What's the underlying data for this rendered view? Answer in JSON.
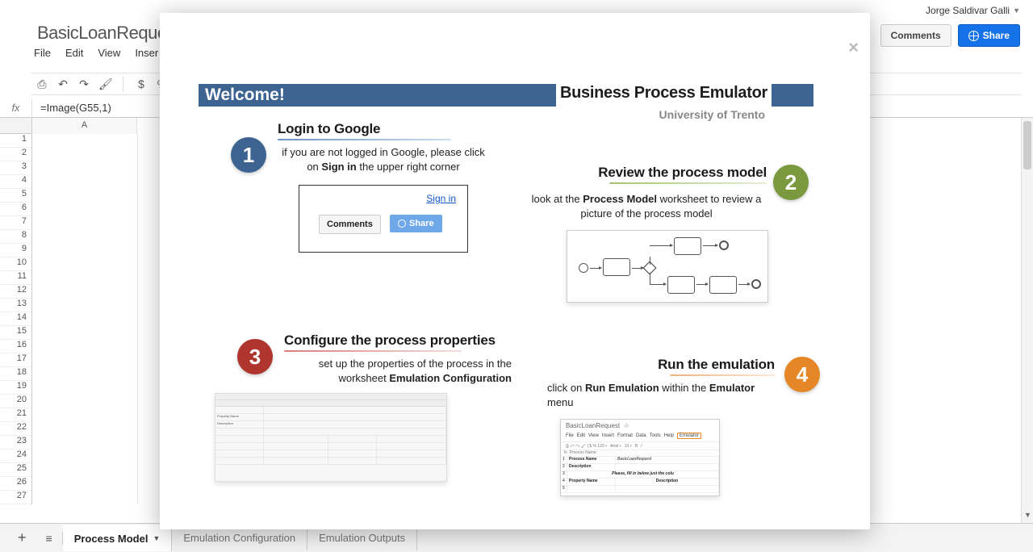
{
  "user": {
    "name": "Jorge Saldivar Galli"
  },
  "doc_title": "BasicLoanReques",
  "buttons": {
    "comments": "Comments",
    "share": "Share"
  },
  "menus": [
    "File",
    "Edit",
    "View",
    "Inser"
  ],
  "toolbar": {
    "dollar": "$",
    "percent": "%"
  },
  "formula": {
    "label": "fx",
    "value": "=Image(G55,1)"
  },
  "columns": [
    "A"
  ],
  "rows": [
    "1",
    "2",
    "3",
    "4",
    "5",
    "6",
    "7",
    "8",
    "9",
    "10",
    "11",
    "12",
    "13",
    "14",
    "15",
    "16",
    "17",
    "18",
    "19",
    "20",
    "21",
    "22",
    "23",
    "24",
    "25",
    "26",
    "27"
  ],
  "sheet_tabs": {
    "add": "+",
    "menu": "≡",
    "active": "Process Model",
    "t2": "Emulation Configuration",
    "t3": "Emulation Outputs"
  },
  "modal": {
    "close": "×",
    "welcome": "Welcome!",
    "app_title": "Business Process Emulator",
    "app_subtitle": "University of Trento",
    "step1": {
      "num": "1",
      "title": "Login to Google",
      "desc_a": "if you are not logged in Google, please click on ",
      "desc_b": "Sign in",
      "desc_c": " the upper right corner",
      "signin": "Sign in",
      "comments": "Comments",
      "share": "Share"
    },
    "step2": {
      "num": "2",
      "title": "Review the process model",
      "desc_a": "look at the ",
      "desc_b": "Process Model",
      "desc_c": " worksheet to review a picture of the process model"
    },
    "step3": {
      "num": "3",
      "title": "Configure the process properties",
      "desc_a": "set up the properties of the process in the worksheet ",
      "desc_b": "Emulation Configuration"
    },
    "step4": {
      "num": "4",
      "title": "Run the emulation",
      "desc_a": "click on ",
      "desc_b": "Run Emulation",
      "desc_c": " within the ",
      "desc_d": "Emulator",
      "desc_e": " menu",
      "thumb_title": "BasicLoanRequest",
      "thumb_menus": [
        "File",
        "Edit",
        "View",
        "Insert",
        "Format",
        "Data",
        "Tools",
        "Help"
      ],
      "thumb_emulator": "Emulator",
      "thumb_fx": "Process Name:",
      "thumb_row1a": "Process Name",
      "thumb_row1b": "BasicLoanRequest",
      "thumb_row2a": "Description",
      "thumb_row3": "Please, fill in below just the colu",
      "thumb_row4a": "Property Name",
      "thumb_row4b": "Description"
    }
  }
}
